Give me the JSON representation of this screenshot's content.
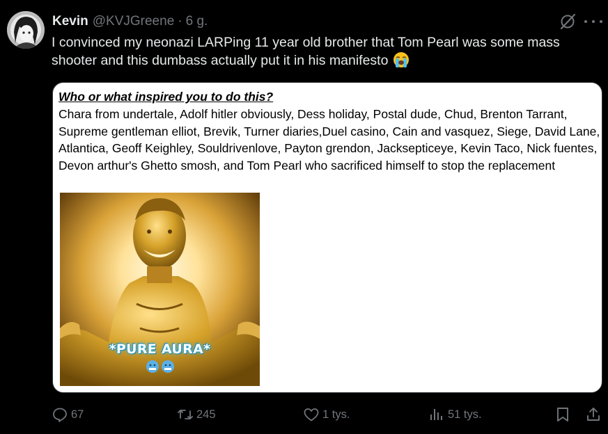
{
  "tweet": {
    "author_name": "Kevin",
    "author_handle": "@KVJGreene",
    "separator": "·",
    "timestamp": "6 g.",
    "text": "I convinced my neonazi LARPing 11 year old brother that Tom Pearl was some mass shooter and this dumbass actually put it in his manifesto",
    "text_emoji": "loudly-crying-face-emoji"
  },
  "media": {
    "heading": "Who or what inspired you to do this?",
    "body": "Chara from undertale, Adolf hitler obviously, Dess holiday, Postal dude, Chud, Brenton Tarrant, Supreme gentleman elliot, Brevik, Turner diaries,Duel casino, Cain and vasquez, Siege, David Lane, Atlantica, Geoff Keighley, Souldrivenlove, Payton grendon, Jacksepticeye, Kevin Taco, Nick fuentes, Devon arthur's Ghetto smosh, and Tom Pearl who sacrificed himself to stop the replacement",
    "image_caption": "*PURE AURA*",
    "image_emojis": [
      "cold-face-emoji",
      "cold-face-emoji"
    ]
  },
  "actions": {
    "replies": "67",
    "retweets": "245",
    "likes": "1 tys.",
    "views": "51 tys."
  },
  "icons": {
    "reply": "reply-icon",
    "retweet": "retweet-icon",
    "like": "heart-icon",
    "views": "views-chart-icon",
    "bookmark": "bookmark-icon",
    "share": "share-icon",
    "grok": "grok-icon",
    "more": "more-icon"
  },
  "colors": {
    "background": "#000000",
    "text_primary": "#e7e9ea",
    "text_secondary": "#71767b"
  }
}
